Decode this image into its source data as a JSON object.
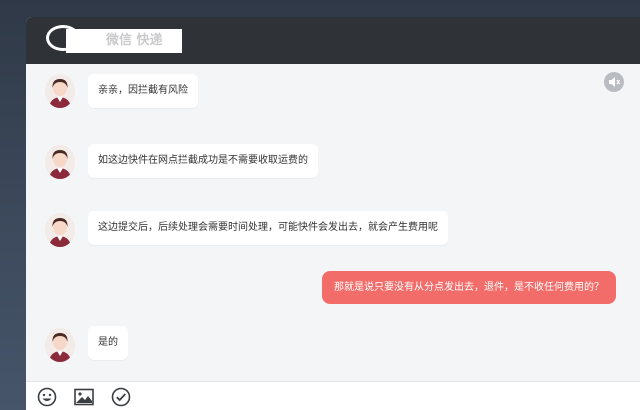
{
  "header": {
    "title": "微信 快递"
  },
  "icons": {
    "mute": "speaker-mute-icon",
    "emoji": "smiley-icon",
    "image": "picture-icon",
    "confirm": "check-circle-icon"
  },
  "colors": {
    "header_bg": "#2f3237",
    "my_bubble": "#f26d6a",
    "agent_bubble": "#ffffff",
    "chat_bg": "#f4f5f7"
  },
  "messages": [
    {
      "sender": "agent",
      "text": "亲亲，因拦截有风险"
    },
    {
      "sender": "agent",
      "text": "如这边快件在网点拦截成功是不需要收取运费的"
    },
    {
      "sender": "agent",
      "text": "这边提交后，后续处理会需要时间处理，可能快件会发出去，就会产生费用呢"
    },
    {
      "sender": "me",
      "text": "那就是说只要没有从分点发出去，退件，是不收任何费用的？"
    },
    {
      "sender": "agent",
      "text": "是的"
    }
  ]
}
